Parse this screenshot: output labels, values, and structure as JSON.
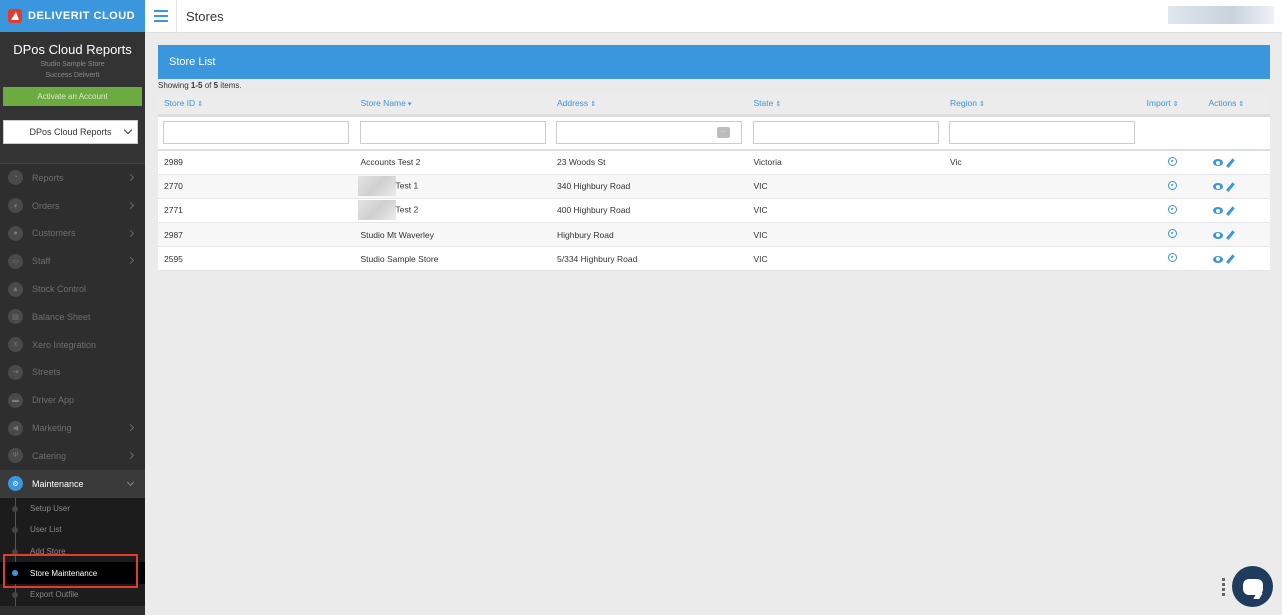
{
  "brand": {
    "name": "DELIVERIT CLOUD"
  },
  "sidebar": {
    "title": "DPos Cloud Reports",
    "store": "Studio Sample Store",
    "subtitle": "Success DeliverIt",
    "activate_label": "Activate an Account",
    "report_select": "DPos Cloud Reports",
    "items": [
      {
        "label": "Reports",
        "icon": "pie-chart-icon",
        "glyph": "◔",
        "has_arrow": true
      },
      {
        "label": "Orders",
        "icon": "cart-icon",
        "glyph": "▾",
        "has_arrow": true
      },
      {
        "label": "Customers",
        "icon": "users-icon",
        "glyph": "●",
        "has_arrow": true
      },
      {
        "label": "Staff",
        "icon": "id-card-icon",
        "glyph": "▭",
        "has_arrow": true
      },
      {
        "label": "Stock Control",
        "icon": "stock-icon",
        "glyph": "▲",
        "has_arrow": false
      },
      {
        "label": "Balance Sheet",
        "icon": "sheet-icon",
        "glyph": "▤",
        "has_arrow": false
      },
      {
        "label": "Xero Integration",
        "icon": "xero-icon",
        "glyph": "x",
        "has_arrow": false
      },
      {
        "label": "Streets",
        "icon": "signpost-icon",
        "glyph": "⇥",
        "has_arrow": false
      },
      {
        "label": "Driver App",
        "icon": "car-icon",
        "glyph": "▬",
        "has_arrow": false
      },
      {
        "label": "Marketing",
        "icon": "megaphone-icon",
        "glyph": "◀",
        "has_arrow": true
      },
      {
        "label": "Catering",
        "icon": "cutlery-icon",
        "glyph": "Ψ",
        "has_arrow": true
      }
    ],
    "active_item": {
      "label": "Maintenance",
      "icon": "cogs-icon",
      "glyph": "⚙"
    },
    "sub_items": [
      "Setup User",
      "User List",
      "Add Store",
      "Store Maintenance",
      "Export Outfile"
    ],
    "active_sub_item": "Store Maintenance"
  },
  "topbar": {
    "title": "Stores"
  },
  "store_list": {
    "heading": "Store List",
    "summary_prefix": "Showing ",
    "summary_range": "1-5",
    "summary_mid": " of ",
    "summary_total": "5",
    "summary_suffix": " items.",
    "columns": [
      "Store ID",
      "Store Name",
      "Address",
      "State",
      "Region",
      "Import",
      "Actions"
    ],
    "column_sort": [
      "⇕",
      "▾",
      "⇕",
      "⇕",
      "⇕",
      "⇕",
      "⇕"
    ],
    "rows": [
      {
        "id": "2989",
        "name": "Accounts Test 2",
        "name_blurred": false,
        "address": "23 Woods St",
        "state": "Victoria",
        "region": "Vic"
      },
      {
        "id": "2770",
        "name": "Test 1",
        "name_blurred": true,
        "address": "340 Highbury Road",
        "state": "VIC",
        "region": ""
      },
      {
        "id": "2771",
        "name": "Test 2",
        "name_blurred": true,
        "address": "400 Highbury Road",
        "state": "VIC",
        "region": ""
      },
      {
        "id": "2987",
        "name": "Studio Mt Waverley",
        "name_blurred": false,
        "address": "Highbury Road",
        "state": "VIC",
        "region": ""
      },
      {
        "id": "2595",
        "name": "Studio Sample Store",
        "name_blurred": false,
        "address": "5/334 Highbury Road",
        "state": "VIC",
        "region": ""
      }
    ]
  },
  "colors": {
    "accent": "#3a96dd",
    "sidebar_bg": "#2e2e2e",
    "activate_green": "#6cab3f",
    "highlight_red": "#e53b2f",
    "chat_bg": "#1f3c5e"
  }
}
